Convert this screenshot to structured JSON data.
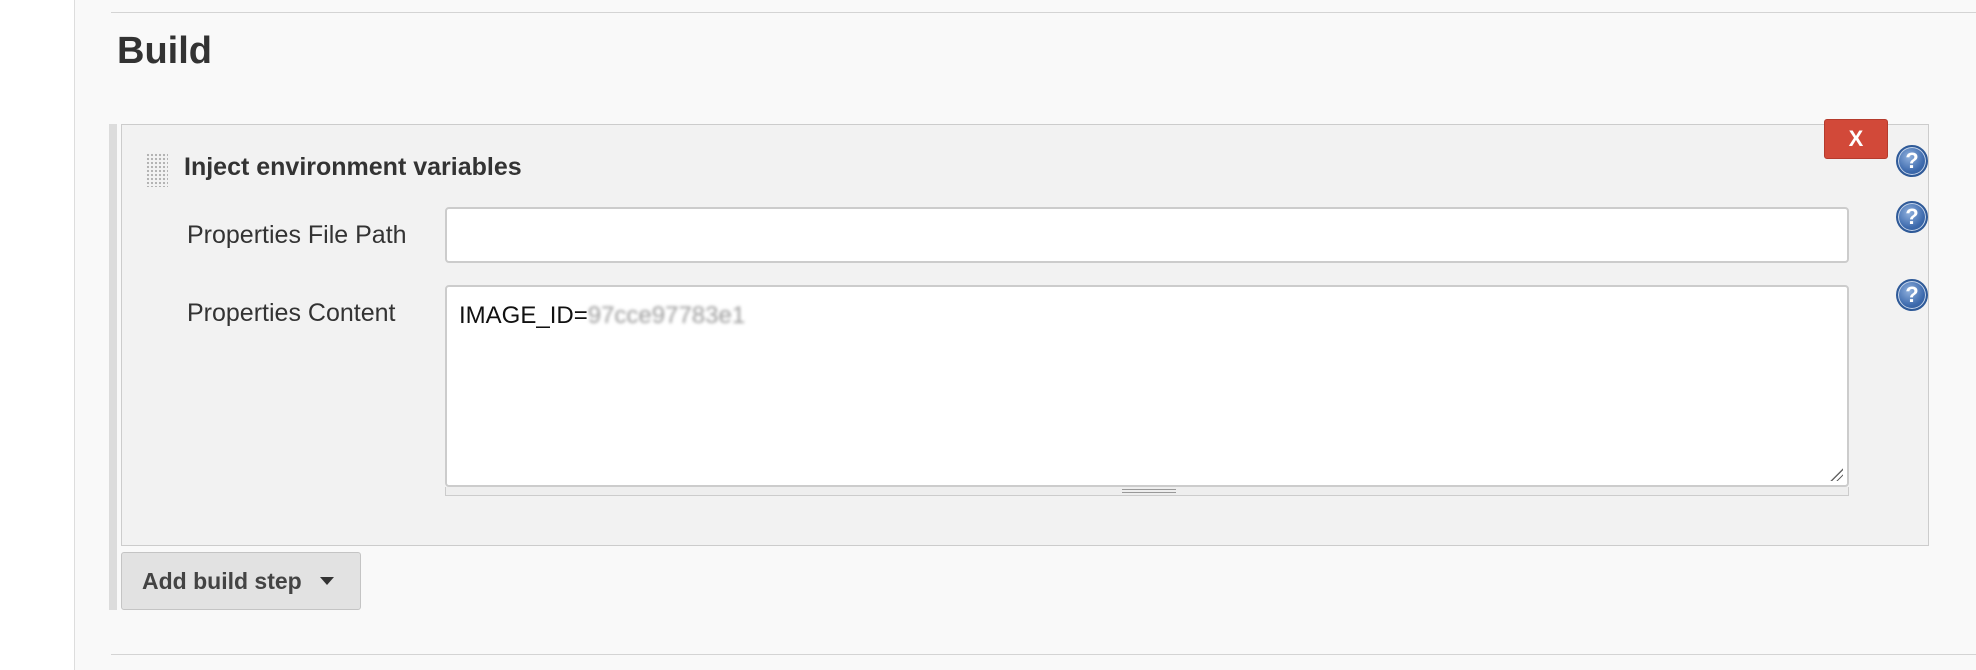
{
  "section": {
    "title": "Build"
  },
  "build_step": {
    "title": "Inject environment variables",
    "delete_label": "X",
    "fields": {
      "file_path": {
        "label": "Properties File Path",
        "value": ""
      },
      "content": {
        "label": "Properties Content",
        "value_prefix": "IMAGE_ID=",
        "value_redacted": "97cce97783e1"
      }
    },
    "help_symbol": "?"
  },
  "add_step": {
    "label": "Add build step",
    "icon": "caret-down-icon"
  },
  "colors": {
    "delete": "#d24939",
    "help": "#3d6aad",
    "panel": "#f9f9f9"
  }
}
